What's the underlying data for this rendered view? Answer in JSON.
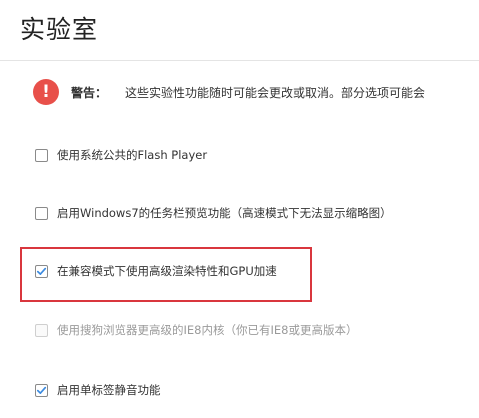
{
  "page": {
    "title": "实验室"
  },
  "warning": {
    "icon": "exclamation-icon",
    "icon_glyph": "!",
    "icon_color": "#e8504a",
    "label": "警告：",
    "text": "这些实验性功能随时可能会更改或取消。部分选项可能会"
  },
  "options": [
    {
      "label": "使用系统公共的Flash Player",
      "checked": false,
      "disabled": false
    },
    {
      "label": "启用Windows7的任务栏预览功能（高速模式下无法显示缩略图）",
      "checked": false,
      "disabled": false
    },
    {
      "label": "在兼容模式下使用高级渲染特性和GPU加速",
      "checked": true,
      "disabled": false
    },
    {
      "label": "使用搜狗浏览器更高级的IE8内核（你已有IE8或更高版本）",
      "checked": false,
      "disabled": true
    },
    {
      "label": "启用单标签静音功能",
      "checked": true,
      "disabled": false
    }
  ],
  "colors": {
    "highlight_border": "#d9363e",
    "check_mark": "#3c8be0"
  }
}
